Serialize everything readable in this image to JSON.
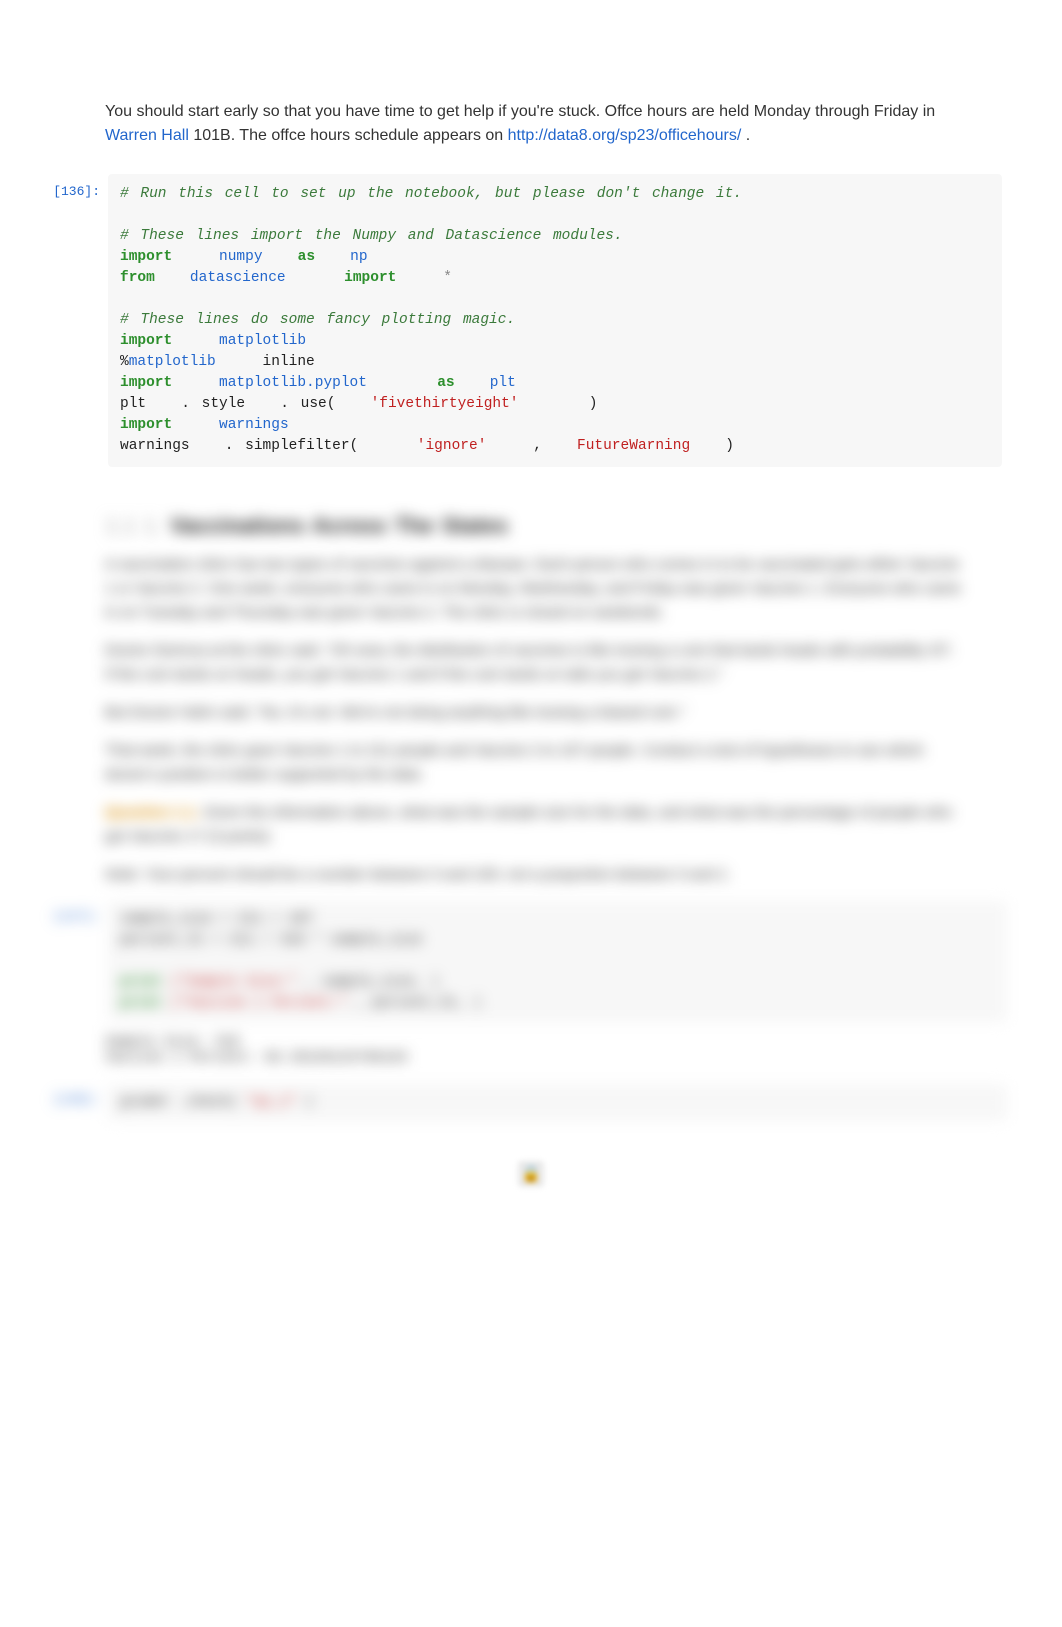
{
  "intro": {
    "text1": "You should start early so that you have time to get help if you're stuck. Offce hours are held Monday through Friday in ",
    "link1": "Warren Hall",
    "text2": " 101B. The offce hours schedule appears on ",
    "link2": "http://data8.org/sp23/officehours/",
    "text3": "."
  },
  "cell1": {
    "label": "[136]:",
    "line1": "# Run this cell to set up the notebook, but please don't change it.",
    "line2": "",
    "line3": "# These lines import the Numpy and Datascience modules.",
    "line4_kw1": "import",
    "line4_mod": "numpy",
    "line4_kw2": "as",
    "line4_alias": "np",
    "line5_kw1": "from",
    "line5_mod": "datascience",
    "line5_kw2": "import",
    "line5_star": "*",
    "line6": "",
    "line7": "# These lines do some fancy plotting magic.",
    "line8_kw": "import",
    "line8_mod": "matplotlib",
    "line9_magic": "%",
    "line9_mod": "matplotlib",
    "line9_arg": " inline",
    "line10_kw1": "import",
    "line10_mod": "matplotlib.pyplot",
    "line10_kw2": "as",
    "line10_alias": "plt",
    "line11_obj": "plt",
    "line11_dot1": ".",
    "line11_attr": "style",
    "line11_dot2": ".",
    "line11_call": "use(",
    "line11_str": "'fivethirtyeight'",
    "line11_close": ")",
    "line12_kw": "import",
    "line12_mod": "warnings",
    "line13_obj": "warnings",
    "line13_dot": ".",
    "line13_call": "simplefilter(",
    "line13_str": "'ignore'",
    "line13_comma": ", ",
    "line13_cls": "FutureWarning",
    "line13_close": ")"
  },
  "blurred": {
    "heading_tag": "1.1   1.",
    "heading": "Vaccinations Across The States",
    "para1": "A vaccination clinic has two types of vaccines against a disease. Each person who comes in to be vaccinated gets either Vaccine 1 or Vaccine 2. One week, everyone who came in on Monday, Wednesday, and Friday was given Vaccine 1. Everyone who came in on Tuesday and Thursday was given Vaccine 2. The clinic is closed on weekends.",
    "para2": "Doctor DeAnza at the clinic said, \"Oh wow, the distribution of vaccines is like tossing a coin that lands heads with probability 3/7. If the coin lands on heads, you get Vaccine 1 and if the coin lands on tails you get Vaccine 2.\"",
    "para3": "But Doctor Hahn said, \"No, it's not. We're not doing anything like tossing a biased coin.\"",
    "para4": "That week, the clinic gave Vaccine 1 to 211 people and Vaccine 2 to 107 people. Conduct a test of hypotheses to see which doctor's position is better supported by the data.",
    "q1_label": "Question 1.1.",
    "q1_text": " Given the information above, what was the sample size for the data, and what was the percentage of people who got Vaccine 1? (3 points)",
    "note": "Note: Your percent should be a number between 0 and 100, not a proportion between 0 and 1.",
    "cell2_label": "[137]:",
    "cell2_line1": "sample_size = 211 + 107",
    "cell2_line2": "percent_V1 = 211 / 318 * sample_size",
    "cell2_line3a": "print",
    "cell2_line3b": "(\"Sample Size:\"",
    "cell2_line3c": ", sample_size, )",
    "cell2_line4a": "print",
    "cell2_line4b": "(\"Vaccine 1 Percent:\"",
    "cell2_line4c": ", percent_V1, )",
    "output1": "Sample Size: 318",
    "output2": "Vaccine 1 Percent: 66.35220125786163",
    "cell3_label": "[138]:",
    "cell3_line1a": "grader",
    "cell3_line1b": ".check(",
    "cell3_line1c": "\"q1_1\"",
    "cell3_line1d": ")"
  }
}
